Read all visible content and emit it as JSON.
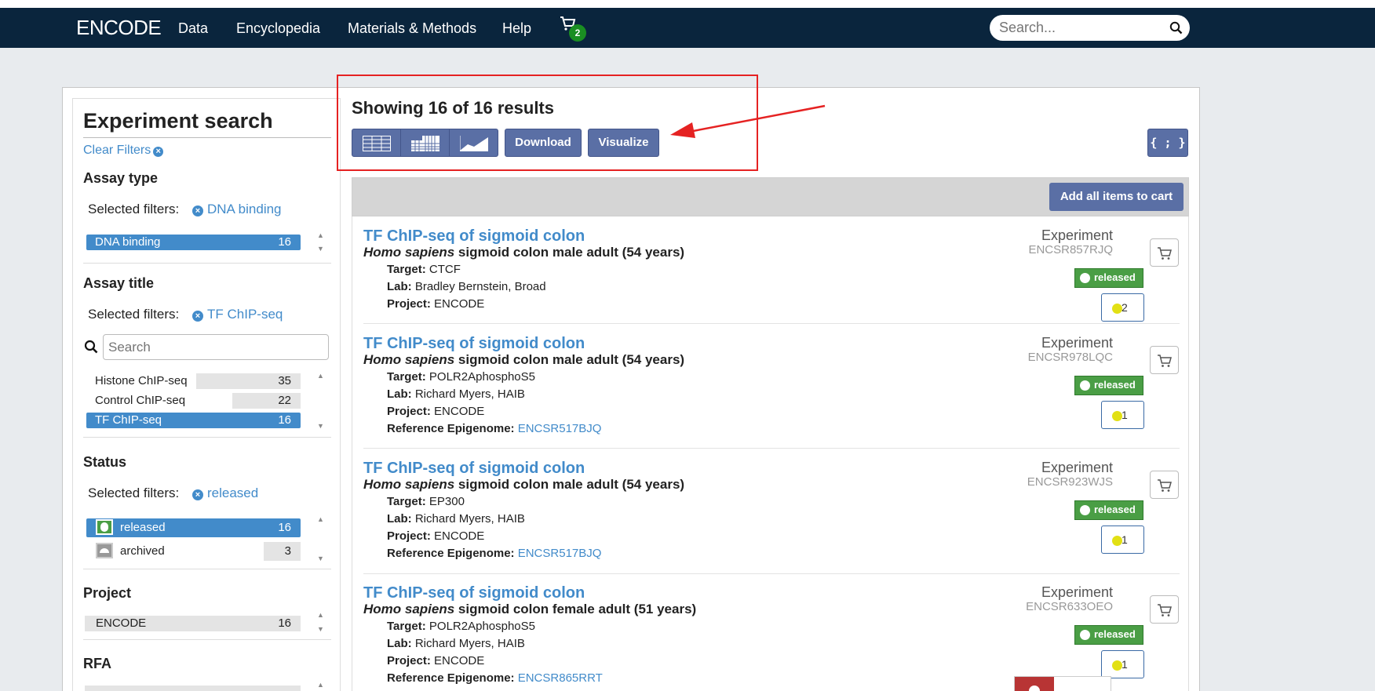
{
  "nav": {
    "brand": "ENCODE",
    "links": [
      "Data",
      "Encyclopedia",
      "Materials & Methods",
      "Help"
    ],
    "cart_count": "2",
    "search_placeholder": "Search..."
  },
  "sidebar": {
    "title": "Experiment search",
    "clear_filters": "Clear Filters",
    "selected_filters_label": "Selected filters:",
    "facets": {
      "assay_type": {
        "heading": "Assay type",
        "selected": "DNA binding",
        "terms": [
          {
            "label": "DNA binding",
            "count": "16",
            "selected": true
          }
        ]
      },
      "assay_title": {
        "heading": "Assay title",
        "selected": "TF ChIP-seq",
        "search_placeholder": "Search",
        "terms": [
          {
            "label": "Histone ChIP-seq",
            "count": "35",
            "selected": false
          },
          {
            "label": "Control ChIP-seq",
            "count": "22",
            "selected": false
          },
          {
            "label": "TF ChIP-seq",
            "count": "16",
            "selected": true
          }
        ]
      },
      "status": {
        "heading": "Status",
        "selected": "released",
        "terms": [
          {
            "label": "released",
            "count": "16",
            "selected": true,
            "color": "#4a9e45"
          },
          {
            "label": "archived",
            "count": "3",
            "selected": false,
            "color": "#999999"
          }
        ]
      },
      "project": {
        "heading": "Project",
        "terms": [
          {
            "label": "ENCODE",
            "count": "16",
            "selected": false
          }
        ]
      },
      "rfa": {
        "heading": "RFA"
      }
    }
  },
  "results": {
    "heading_prefix": "Showing ",
    "heading_shown": "16",
    "heading_of": " of ",
    "heading_total": "16",
    "heading_suffix": " results",
    "view_buttons": [
      "table-icon",
      "matrix-icon",
      "chart-icon"
    ],
    "download_label": "Download",
    "visualize_label": "Visualize",
    "json_label": "{ ; }",
    "add_all_label": "Add all items to cart",
    "items": [
      {
        "title": "TF ChIP-seq of sigmoid colon",
        "organism": "Homo sapiens",
        "biosample": " sigmoid colon male adult (54 years)",
        "target_label": "Target:",
        "target": "CTCF",
        "lab_label": "Lab:",
        "lab": "Bradley Bernstein, Broad",
        "project_label": "Project:",
        "project": "ENCODE",
        "ref_label": "",
        "ref": "",
        "type": "Experiment",
        "accession": "ENCSR857RJQ",
        "status": "released",
        "audit_count": "2"
      },
      {
        "title": "TF ChIP-seq of sigmoid colon",
        "organism": "Homo sapiens",
        "biosample": " sigmoid colon male adult (54 years)",
        "target_label": "Target:",
        "target": "POLR2AphosphoS5",
        "lab_label": "Lab:",
        "lab": "Richard Myers, HAIB",
        "project_label": "Project:",
        "project": "ENCODE",
        "ref_label": "Reference Epigenome:",
        "ref": "ENCSR517BJQ",
        "type": "Experiment",
        "accession": "ENCSR978LQC",
        "status": "released",
        "audit_count": "1"
      },
      {
        "title": "TF ChIP-seq of sigmoid colon",
        "organism": "Homo sapiens",
        "biosample": " sigmoid colon male adult (54 years)",
        "target_label": "Target:",
        "target": "EP300",
        "lab_label": "Lab:",
        "lab": "Richard Myers, HAIB",
        "project_label": "Project:",
        "project": "ENCODE",
        "ref_label": "Reference Epigenome:",
        "ref": "ENCSR517BJQ",
        "type": "Experiment",
        "accession": "ENCSR923WJS",
        "status": "released",
        "audit_count": "1"
      },
      {
        "title": "TF ChIP-seq of sigmoid colon",
        "organism": "Homo sapiens",
        "biosample": " sigmoid colon female adult (51 years)",
        "target_label": "Target:",
        "target": "POLR2AphosphoS5",
        "lab_label": "Lab:",
        "lab": "Richard Myers, HAIB",
        "project_label": "Project:",
        "project": "ENCODE",
        "ref_label": "Reference Epigenome:",
        "ref": "ENCSR865RRT",
        "type": "Experiment",
        "accession": "ENCSR633OEO",
        "status": "released",
        "audit_count": "1"
      }
    ]
  },
  "colors": {
    "navbar": "#0a253d",
    "accent": "#428bca",
    "button": "#5a6fa5",
    "released": "#4a9e45",
    "annotation": "#e52222"
  }
}
